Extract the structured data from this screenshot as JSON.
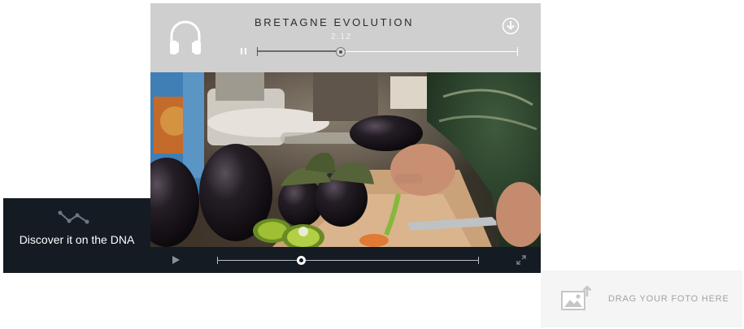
{
  "audio_player": {
    "title": "BRETAGNE EVOLUTION",
    "time": "2.12",
    "progress": 0.32,
    "icons": {
      "headphones": "headphones-icon",
      "pause": "pause-icon",
      "download": "download-icon"
    }
  },
  "video_player": {
    "progress": 0.32,
    "icons": {
      "play": "play-icon",
      "fullscreen": "fullscreen-icon"
    }
  },
  "dna_panel": {
    "text": "Discover it on the DNA",
    "icon": "dna-graph-icon"
  },
  "dropzone": {
    "label": "DRAG YOUR FOTO HERE",
    "icon": "image-upload-icon"
  },
  "colors": {
    "audio_bg": "#cfcfcf",
    "dark_panel": "#141b22",
    "dropzone_bg": "#f5f5f5"
  }
}
